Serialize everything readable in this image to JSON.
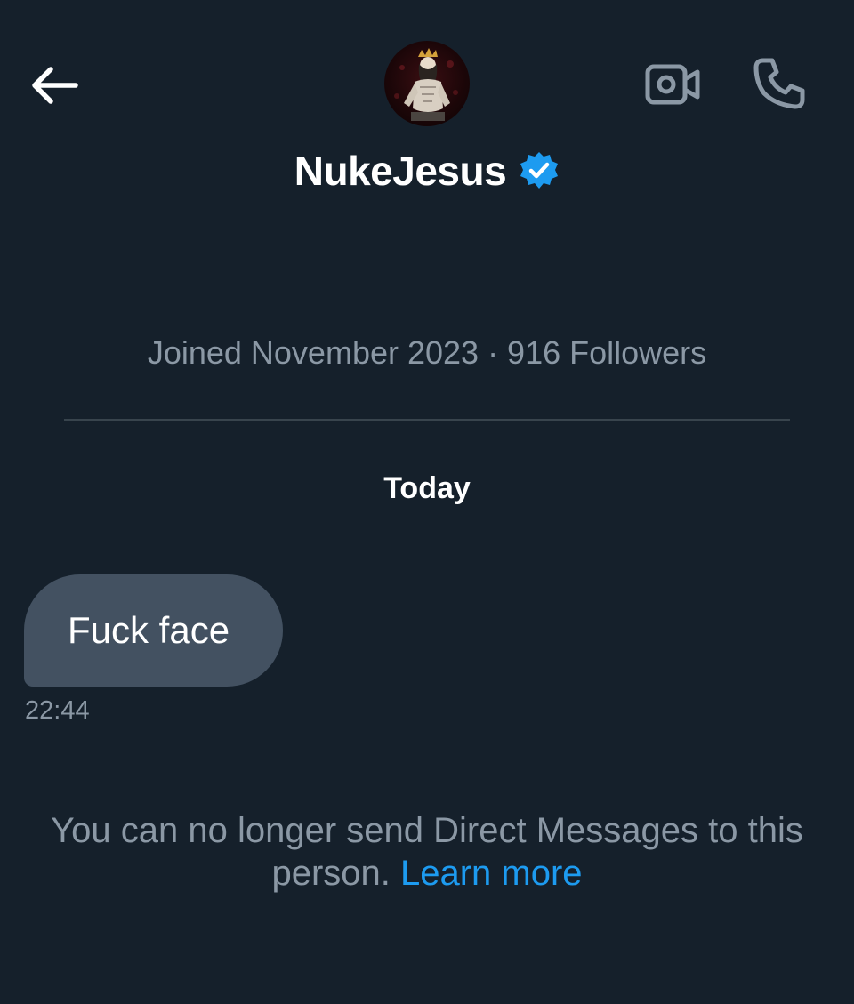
{
  "header": {
    "back_icon": "arrow-left-icon",
    "avatar_alt": "NukeJesus avatar",
    "display_name": "NukeJesus",
    "verified_icon": "verified-badge-icon",
    "video_icon": "video-camera-icon",
    "call_icon": "phone-icon"
  },
  "profile": {
    "joined": "Joined November 2023 · 916 Followers"
  },
  "conversation": {
    "day_label": "Today",
    "messages": [
      {
        "text": "Fuck face",
        "time": "22:44"
      }
    ]
  },
  "notice": {
    "text_line1": "You can no longer send Direct Messages to this",
    "text_line2": "person. ",
    "link": "Learn more"
  },
  "colors": {
    "background": "#15202b",
    "bubble": "#435161",
    "muted": "#8b98a5",
    "link": "#1d9bf0",
    "verified": "#1d9bf0"
  }
}
